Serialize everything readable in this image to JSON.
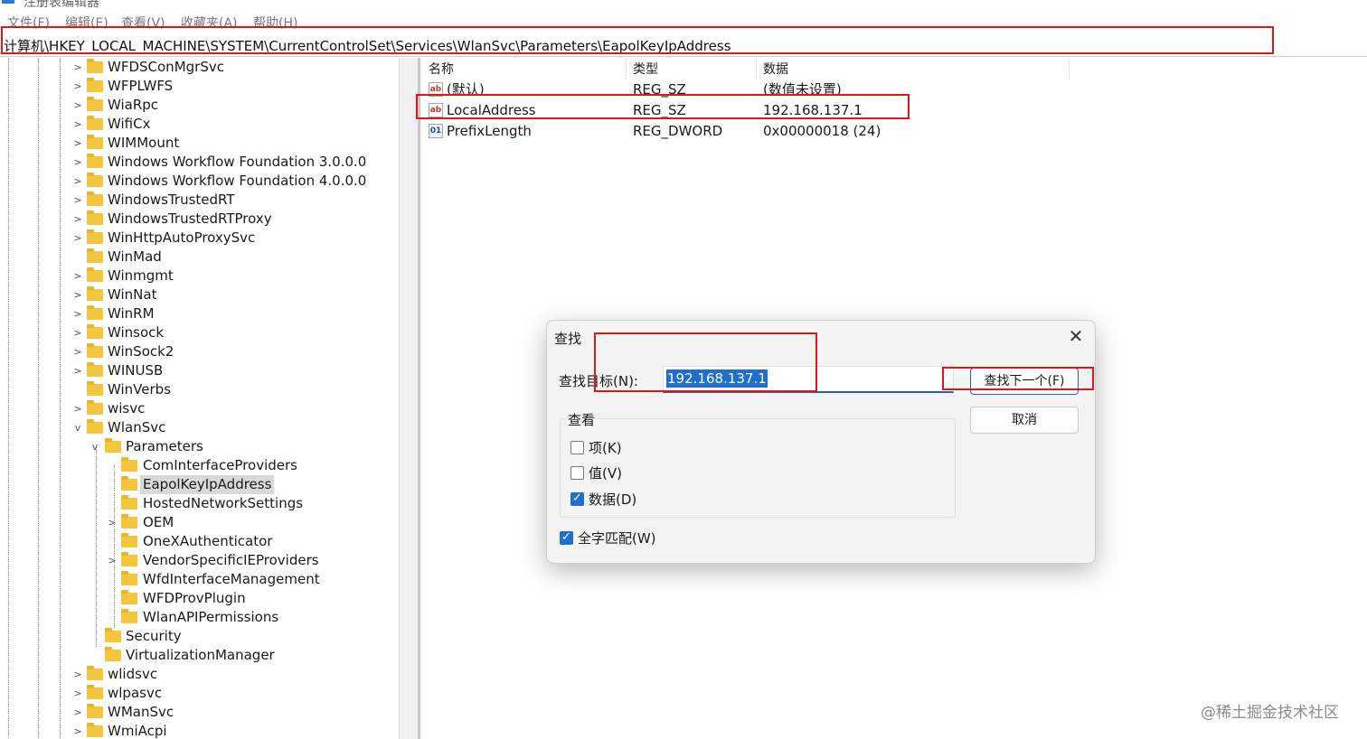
{
  "window": {
    "title": "注册表编辑器"
  },
  "menu": [
    "文件(F)",
    "编辑(E)",
    "查看(V)",
    "收藏夹(A)",
    "帮助(H)"
  ],
  "address": "计算机\\HKEY_LOCAL_MACHINE\\SYSTEM\\CurrentControlSet\\Services\\WlanSvc\\Parameters\\EapolKeyIpAddress",
  "tree": [
    {
      "label": "WFDSConMgrSvc"
    },
    {
      "label": "WFPLWFS"
    },
    {
      "label": "WiaRpc"
    },
    {
      "label": "WifiCx"
    },
    {
      "label": "WIMMount"
    },
    {
      "label": "Windows Workflow Foundation 3.0.0.0"
    },
    {
      "label": "Windows Workflow Foundation 4.0.0.0"
    },
    {
      "label": "WindowsTrustedRT"
    },
    {
      "label": "WindowsTrustedRTProxy"
    },
    {
      "label": "WinHttpAutoProxySvc"
    },
    {
      "label": "WinMad"
    },
    {
      "label": "Winmgmt"
    },
    {
      "label": "WinNat"
    },
    {
      "label": "WinRM"
    },
    {
      "label": "Winsock"
    },
    {
      "label": "WinSock2"
    },
    {
      "label": "WINUSB"
    },
    {
      "label": "WinVerbs"
    },
    {
      "label": "wisvc"
    },
    {
      "label": "WlanSvc"
    },
    {
      "label": "Parameters"
    },
    {
      "label": "ComInterfaceProviders"
    },
    {
      "label": "EapolKeyIpAddress"
    },
    {
      "label": "HostedNetworkSettings"
    },
    {
      "label": "OEM"
    },
    {
      "label": "OneXAuthenticator"
    },
    {
      "label": "VendorSpecificIEProviders"
    },
    {
      "label": "WfdInterfaceManagement"
    },
    {
      "label": "WFDProvPlugin"
    },
    {
      "label": "WlanAPIPermissions"
    },
    {
      "label": "Security"
    },
    {
      "label": "VirtualizationManager"
    },
    {
      "label": "wlidsvc"
    },
    {
      "label": "wlpasvc"
    },
    {
      "label": "WManSvc"
    },
    {
      "label": "WmiAcpi"
    }
  ],
  "list": {
    "headers": {
      "name": "名称",
      "type": "类型",
      "data": "数据"
    },
    "rows": [
      {
        "icon": "string-value-icon",
        "name": "(默认)",
        "type": "REG_SZ",
        "data": "(数值未设置)"
      },
      {
        "icon": "string-value-icon",
        "name": "LocalAddress",
        "type": "REG_SZ",
        "data": "192.168.137.1"
      },
      {
        "icon": "binary-value-icon",
        "name": "PrefixLength",
        "type": "REG_DWORD",
        "data": "0x00000018 (24)"
      }
    ]
  },
  "find_dialog": {
    "title": "查找",
    "close": "✕",
    "find_label": "查找目标(N):",
    "find_value": "192.168.137.1",
    "find_next": "查找下一个(F)",
    "cancel": "取消",
    "look_at": "查看",
    "keys": {
      "label": "项(K)",
      "checked": false
    },
    "values": {
      "label": "值(V)",
      "checked": false
    },
    "data": {
      "label": "数据(D)",
      "checked": true
    },
    "whole_string": {
      "label": "全字匹配(W)",
      "checked": true
    }
  },
  "watermark": "@稀土掘金技术社区",
  "colors": {
    "highlight": "#e0161c",
    "accent": "#1f6fd0",
    "folder": "#f3c63d"
  }
}
